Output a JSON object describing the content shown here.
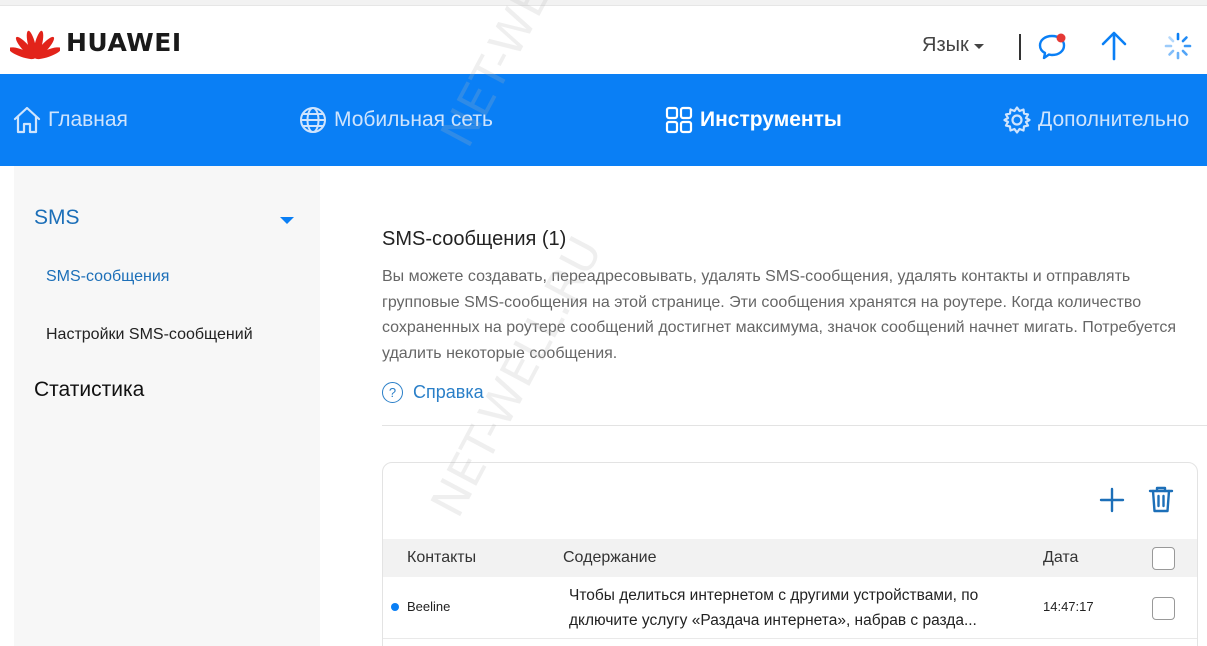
{
  "brand": {
    "name": "HUAWEI"
  },
  "header": {
    "language_label": "Язык"
  },
  "nav": [
    {
      "label": "Главная",
      "icon": "home-icon",
      "active": false
    },
    {
      "label": "Мобильная сеть",
      "icon": "globe-icon",
      "active": false
    },
    {
      "label": "Инструменты",
      "icon": "tools-grid-icon",
      "active": true
    },
    {
      "label": "Дополнительно",
      "icon": "gear-icon",
      "active": false
    }
  ],
  "sidebar": {
    "sms_group": "SMS",
    "sms_items": [
      "SMS-сообщения",
      "Настройки SMS-сообщений"
    ],
    "statistics": "Статистика"
  },
  "content": {
    "title": "SMS-сообщения (1)",
    "description": "Вы можете создавать, переадресовывать, удалять SMS-сообщения, удалять контакты и отправлять групповые SMS-сообщения на этой странице. Эти сообщения хранятся на роутере. Когда количество сохраненных на роутере сообщений достигнет максимума, значок сообщений начнет мигать. Потребуется удалить некоторые сообщения.",
    "help_label": "Справка"
  },
  "table": {
    "headers": {
      "contacts": "Контакты",
      "content": "Содержание",
      "date": "Дата"
    },
    "rows": [
      {
        "contact": "Beeline",
        "content_line1": "Чтобы делиться интернетом с другими устройствами, по",
        "content_line2": "дключите услугу «Раздача интернета», набрав с разда...",
        "time": "14:47:17",
        "unread": true
      }
    ]
  },
  "watermark": "NET-WELL.RU",
  "colors": {
    "nav_bg": "#0a7ff5",
    "accent": "#1c6fb8",
    "unread_dot": "#0a7ff5",
    "notify_dot": "#e53935"
  }
}
